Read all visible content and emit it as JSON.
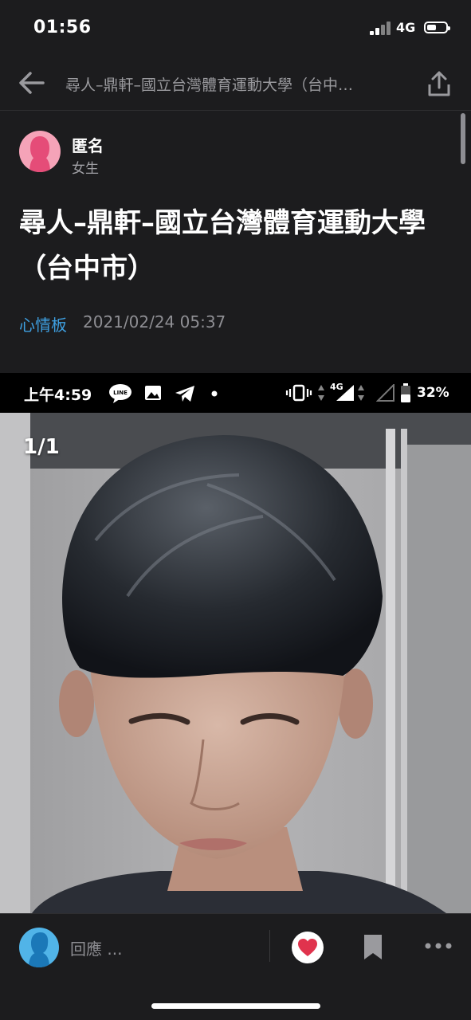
{
  "status_bar": {
    "time": "01:56",
    "network": "4G",
    "icons": [
      "signal-icon",
      "battery-icon"
    ]
  },
  "nav": {
    "title": "尋人–鼎軒–國立台灣體育運動大學（台中…",
    "icons": [
      "back-arrow-icon",
      "share-icon"
    ]
  },
  "author": {
    "name": "匿名",
    "gender": "女生",
    "icon": "female-avatar-icon"
  },
  "post": {
    "title": "尋人–鼎軒–國立台灣體育運動大學（台中市）",
    "board": "心情板",
    "date": "2021/02/24 05:37"
  },
  "embedded_screenshot": {
    "time": "上午4:59",
    "battery": "32%",
    "network": "4G",
    "line_label": "LINE",
    "icons": [
      "line-icon",
      "gallery-icon",
      "telegram-icon",
      "dot-icon",
      "vibrate-icon",
      "data-arrows-icon",
      "signal-icon",
      "battery-icon"
    ],
    "page_indicator": "1/1"
  },
  "bottom_bar": {
    "reply_placeholder": "回應 ...",
    "icons": [
      "user-avatar-icon",
      "heart-icon",
      "bookmark-icon",
      "more-icon"
    ]
  },
  "colors": {
    "background": "#1c1c1e",
    "board_link": "#3e9fe0",
    "heart": "#e0334d",
    "avatar_female": "#f5a3b8",
    "avatar_user": "#51b4e8"
  }
}
